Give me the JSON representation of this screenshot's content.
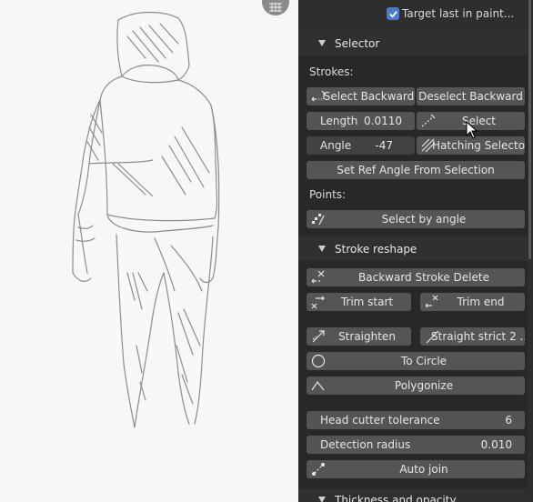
{
  "panel": {
    "target_last": "Target last in paint...",
    "selector": {
      "header": "Selector",
      "strokes_label": "Strokes:",
      "select_backward": "Select Backward",
      "deselect_backward": "Deselect Backward",
      "length_label": "Length",
      "length_value": "0.0110",
      "select": "Select",
      "angle_label": "Angle",
      "angle_value": "-47",
      "hatching_selector": "Hatching Selector",
      "set_ref_angle": "Set Ref Angle From Selection",
      "points_label": "Points:",
      "select_by_angle": "Select by angle"
    },
    "stroke_reshape": {
      "header": "Stroke reshape",
      "backward_delete": "Backward Stroke Delete",
      "trim_start": "Trim start",
      "trim_end": "Trim end",
      "straighten": "Straighten",
      "straight_strict": "Straight strict 2 ...",
      "to_circle": "To Circle",
      "polygonize": "Polygonize",
      "head_cutter_label": "Head cutter tolerance",
      "head_cutter_value": "6",
      "detection_label": "Detection radius",
      "detection_value": "0.010",
      "auto_join": "Auto join"
    },
    "thickness_header": "Thickness and opacity"
  },
  "colors": {
    "panel_bg": "#2e2e2e",
    "button": "#555555",
    "checkbox": "#4a7bc9",
    "viewport_bg": "#f7f7f7"
  }
}
